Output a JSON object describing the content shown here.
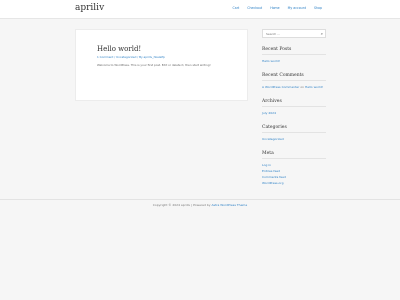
{
  "site": {
    "title": "apriliv"
  },
  "nav": {
    "items": [
      "Cart",
      "Checkout",
      "Home",
      "My account",
      "Shop"
    ]
  },
  "post": {
    "title": "Hello world!",
    "meta": "1 Comment / Uncategorized / By apriliv_hbelelfp",
    "excerpt": "Welcome to WordPress. This is your first post. Edit or delete it, then start writing!"
  },
  "search": {
    "placeholder": "Search ...",
    "icon": "search-icon"
  },
  "widgets": {
    "recent_posts": {
      "title": "Recent Posts",
      "items": [
        "Hello world!"
      ]
    },
    "recent_comments": {
      "title": "Recent Comments",
      "author": "A WordPress Commenter",
      "on": "on",
      "post": "Hello world!"
    },
    "archives": {
      "title": "Archives",
      "items": [
        "July 2024"
      ]
    },
    "categories": {
      "title": "Categories",
      "items": [
        "Uncategorized"
      ]
    },
    "meta": {
      "title": "Meta",
      "items": [
        "Log in",
        "Entries feed",
        "Comments feed",
        "WordPress.org"
      ]
    }
  },
  "footer": {
    "text": "Copyright © 2024 apriliv | Powered by",
    "link": "Astra WordPress Theme"
  },
  "colors": {
    "link": "#2a7fc5",
    "background": "#f6f6f6",
    "card": "#ffffff"
  }
}
